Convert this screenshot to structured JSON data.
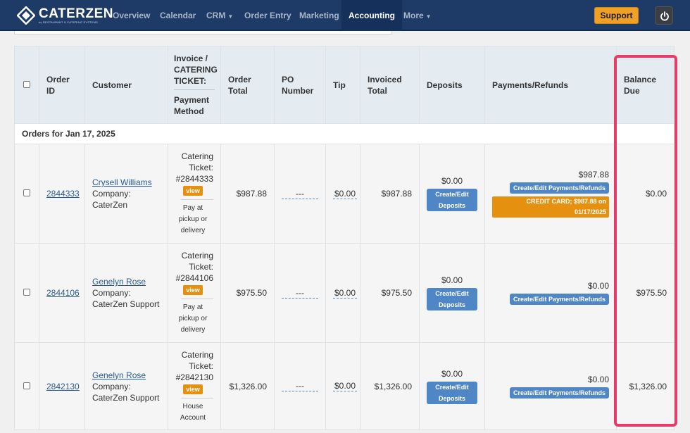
{
  "brand": {
    "name": "CATERZEN",
    "tagline": "by RESTAURANT & CATERING SYSTEMS"
  },
  "nav": {
    "items": [
      "Overview",
      "Calendar",
      "CRM",
      "Order Entry",
      "Marketing",
      "Accounting",
      "More"
    ],
    "active": "Accounting",
    "support_label": "Support",
    "power_icon": "power-icon"
  },
  "table": {
    "headers": {
      "order_id": "Order ID",
      "customer": "Customer",
      "invoice_top": "Invoice / CATERING TICKET:",
      "invoice_bottom": "Payment Method",
      "order_total": "Order Total",
      "po_number": "PO Number",
      "tip": "Tip",
      "invoiced_total": "Invoiced Total",
      "deposits": "Deposits",
      "payments_refunds": "Payments/Refunds",
      "balance_due": "Balance Due"
    },
    "group_label": "Orders for Jan 17, 2025",
    "rows": [
      {
        "order_id": "2844333",
        "customer_name": "Crysell Williams",
        "company_label": "Company:",
        "company": "CaterZen",
        "ticket_label": "Catering Ticket:",
        "ticket_no": "#2844333",
        "view": "view",
        "pay_method_1": "Pay at",
        "pay_method_2": "pickup or",
        "pay_method_3": "delivery",
        "order_total": "$987.88",
        "po": "---",
        "tip": "$0.00",
        "invoiced_total": "$987.88",
        "deposit": "$0.00",
        "deposit_btn_1": "Create/Edit",
        "deposit_btn_2": "Deposits",
        "payments": "$987.88",
        "payments_btn": "Create/Edit Payments/Refunds",
        "cc_tag": "CREDIT CARD; $987.88 on 01/17/2025",
        "balance": "$0.00"
      },
      {
        "order_id": "2844106",
        "customer_name": "Genelyn Rose",
        "company_label": "Company:",
        "company": "CaterZen Support",
        "ticket_label": "Catering Ticket:",
        "ticket_no": "#2844106",
        "view": "view",
        "pay_method_1": "Pay at",
        "pay_method_2": "pickup or",
        "pay_method_3": "delivery",
        "order_total": "$975.50",
        "po": "---",
        "tip": "$0.00",
        "invoiced_total": "$975.50",
        "deposit": "$0.00",
        "deposit_btn_1": "Create/Edit",
        "deposit_btn_2": "Deposits",
        "payments": "$0.00",
        "payments_btn": "Create/Edit Payments/Refunds",
        "balance": "$975.50"
      },
      {
        "order_id": "2842130",
        "customer_name": "Genelyn Rose",
        "company_label": "Company:",
        "company": "CaterZen Support",
        "ticket_label": "Catering Ticket:",
        "ticket_no": "#2842130",
        "view": "view",
        "pay_method_1": "House",
        "pay_method_2": "Account",
        "order_total": "$1,326.00",
        "po": "---",
        "tip": "$0.00",
        "invoiced_total": "$1,326.00",
        "deposit": "$0.00",
        "deposit_btn_1": "Create/Edit",
        "deposit_btn_2": "Deposits",
        "payments": "$0.00",
        "payments_btn": "Create/Edit Payments/Refunds",
        "balance": "$1,326.00"
      }
    ]
  },
  "colors": {
    "navbar": "#1e3a66",
    "accent": "#f0a125",
    "highlight": "#e83b6a",
    "button_blue": "#4f86c6"
  }
}
